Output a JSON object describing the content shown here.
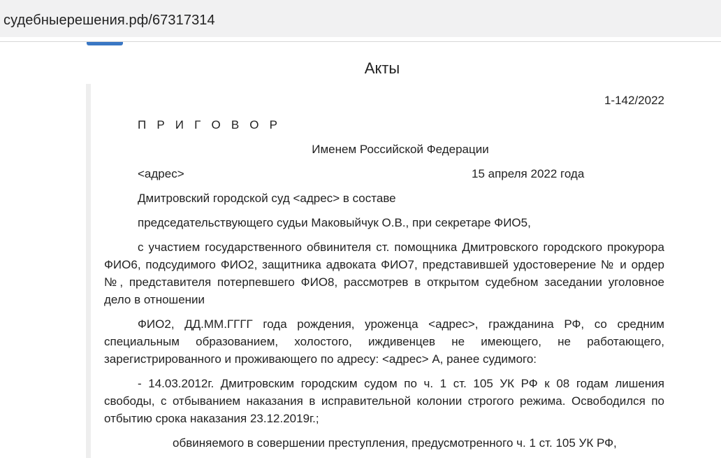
{
  "address_bar": {
    "url": "судебныерешения.рф/67317314"
  },
  "section": {
    "title": "Акты"
  },
  "document": {
    "case_number": "1-142/2022",
    "title": "П Р И Г О В О Р",
    "name_line": "Именем Российской Федерации",
    "place": "<адрес>",
    "date": "15 апреля 2022 года",
    "paragraphs": {
      "court": "Дмитровский городской суд <адрес> в составе",
      "judge": "председательствующего судьи Маковыйчук О.В., при секретаре ФИО5,",
      "participants": "с участием государственного обвинителя ст. помощника Дмитровского городского прокурора ФИО6, подсудимого ФИО2, защитника адвоката ФИО7, представившей удостоверение № и ордер №, представителя потерпевшего ФИО8, рассмотрев в открытом судебном заседании уголовное дело в отношении",
      "defendant": "ФИО2, ДД.ММ.ГГГГ года рождения, уроженца <адрес>, гражданина РФ, со средним специальным образованием, холостого, иждивенцев не имеющего, не работающего, зарегистрированного и проживающего по адресу: <адрес> А, ранее судимого:",
      "conviction": "- 14.03.2012г. Дмитровским городским судом по ч. 1 ст. 105 УК РФ к 08 годам лишения свободы, с отбыванием наказания в исправительной колонии строгого режима. Освободился по отбытию срока наказания 23.12.2019г.;",
      "charged": "обвиняемого в совершении преступления, предусмотренного ч. 1 ст. 105 УК РФ,"
    }
  },
  "colors": {
    "url_bar_bg": "#f1f1f2",
    "tab_accent": "#3a77c4",
    "doc_bar": "#eeeeee",
    "text": "#222222"
  }
}
